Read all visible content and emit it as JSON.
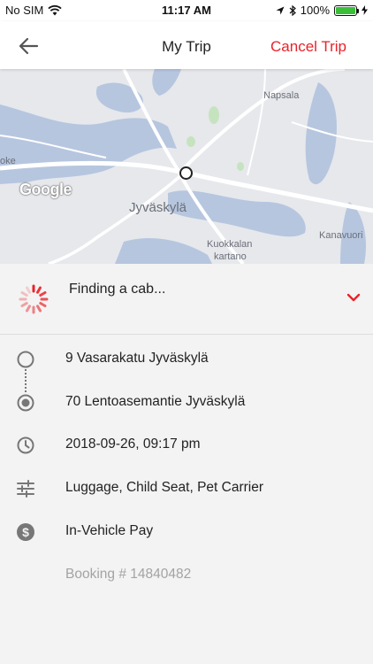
{
  "status_bar": {
    "carrier": "No SIM",
    "time": "11:17 AM",
    "battery": "100%",
    "battery_level": 1.0,
    "battery_color": "#3bbf3b"
  },
  "nav": {
    "back_icon": "arrow-left-icon",
    "title": "My Trip",
    "cancel_label": "Cancel Trip",
    "accent_color": "#e8232a"
  },
  "map": {
    "labels": {
      "napsala": "Napsala",
      "oke": "oke",
      "city": "Jyväskylä",
      "kuokkalan": "Kuokkalan",
      "kartano": "kartano",
      "kanavuori": "Kanavuori"
    },
    "google": "Google"
  },
  "trip_status": {
    "text": "Finding a cab...",
    "spinner_icon": "loading-spinner-icon",
    "expand_icon": "chevron-down-icon"
  },
  "details": {
    "pickup": "9 Vasarakatu Jyväskylä",
    "dropoff": "70 Lentoasemantie Jyväskylä",
    "datetime": "2018-09-26, 09:17 pm",
    "options": "Luggage, Child Seat, Pet Carrier",
    "payment": "In-Vehicle Pay",
    "booking": "Booking # 14840482"
  }
}
